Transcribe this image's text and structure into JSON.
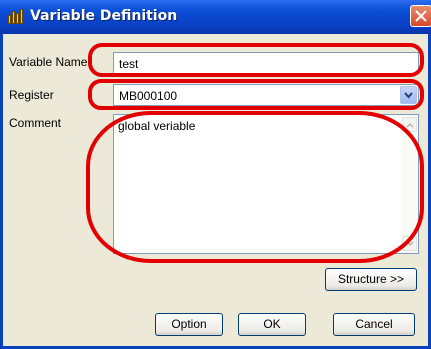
{
  "window": {
    "title": "Variable Definition"
  },
  "form": {
    "variable_name_label": "Variable Name",
    "variable_name_value": "test",
    "register_label": "Register",
    "register_value": "MB000100",
    "comment_label": "Comment",
    "comment_value": "global veriable"
  },
  "buttons": {
    "structure": "Structure >>",
    "option": "Option",
    "ok": "OK",
    "cancel": "Cancel"
  },
  "colors": {
    "titlebar": "#0a3fc2",
    "dialog_bg": "#ece9d8",
    "highlight_ring": "#e30000",
    "close_button": "#d8482a"
  },
  "icons": [
    "app-icon",
    "close-icon",
    "chevron-down-icon",
    "scroll-up-icon",
    "scroll-down-icon"
  ]
}
